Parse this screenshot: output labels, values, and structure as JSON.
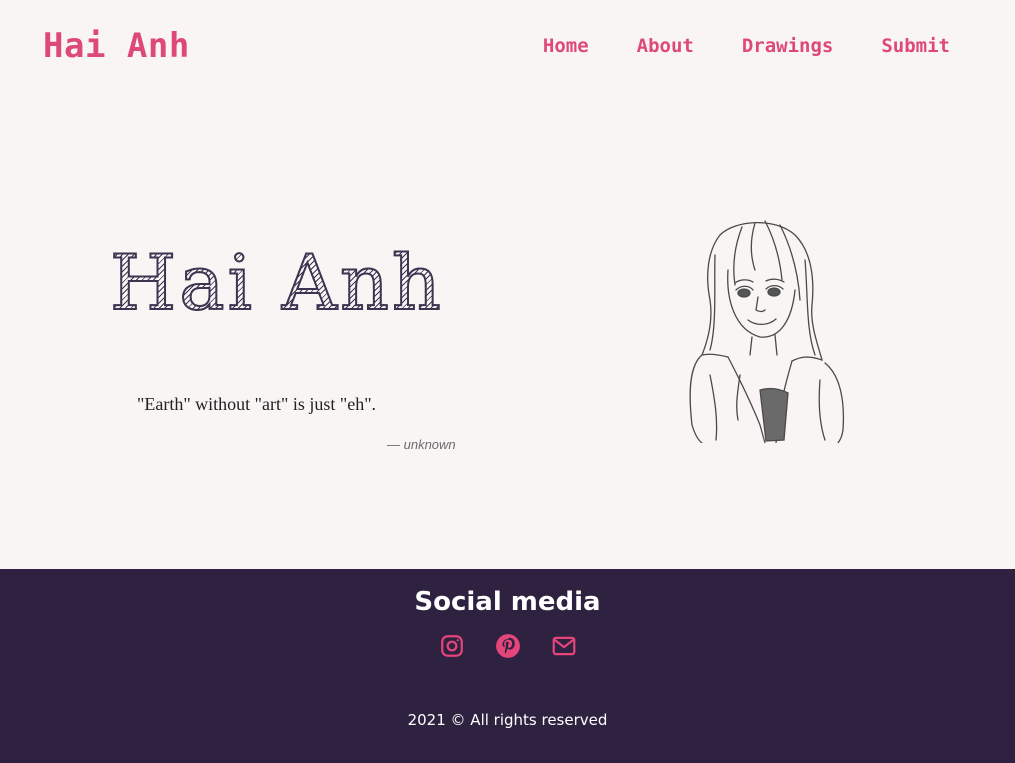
{
  "header": {
    "brand": "Hai Anh",
    "nav": [
      "Home",
      "About",
      "Drawings",
      "Submit"
    ]
  },
  "hero": {
    "title": "Hai Anh",
    "quote": "\"Earth\" without \"art\" is just \"eh\".",
    "cite": "— unknown",
    "portrait_icon": "sketch-portrait-illustration"
  },
  "footer": {
    "heading": "Social media",
    "socials": [
      "instagram-icon",
      "pinterest-icon",
      "email-icon"
    ],
    "copyright": "2021 © All rights reserved"
  },
  "colors": {
    "accent": "#de4a78",
    "background": "#faf5f5",
    "footer_bg": "#2e2240"
  }
}
